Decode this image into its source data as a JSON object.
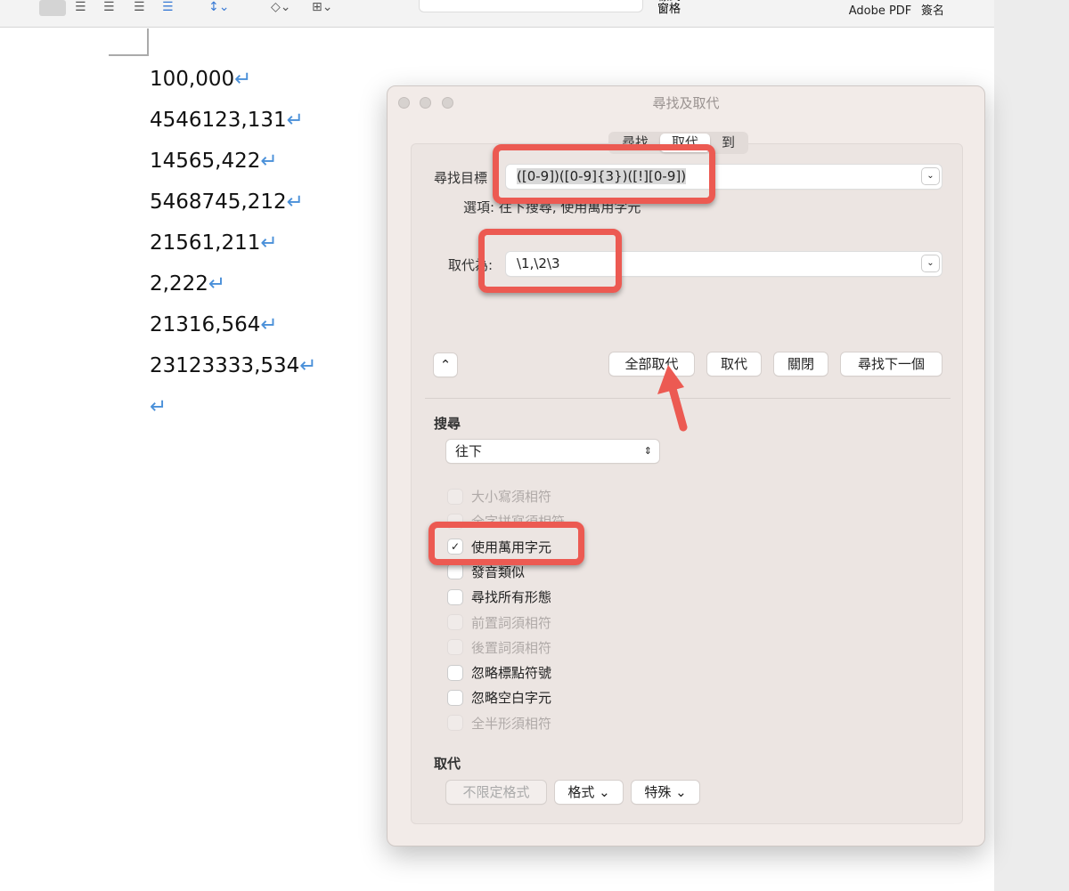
{
  "toolbar": {
    "styles_pane": "樣式\n窗格",
    "styles_pane_line2": "窗格",
    "adobe_pdf": "Adobe PDF",
    "request_sign": "簽名"
  },
  "document": {
    "lines": [
      "100,000",
      "4546123,131",
      "14565,422",
      "5468745,212",
      "21561,211",
      "2,222",
      "21316,564",
      "23123333,534",
      ""
    ],
    "return_mark": "↵"
  },
  "dialog": {
    "title": "尋找及取代",
    "tabs": [
      "尋找",
      "取代",
      "到"
    ],
    "active_tab": "取代",
    "find_label": "尋找目標",
    "find_value": "([0-9])([0-9]{3})([!][0-9])",
    "options_text": "選項: 往下搜尋, 使用萬用字元",
    "replace_label": "取代為:",
    "replace_value": "\\1,\\2\\3",
    "buttons": {
      "replace_all": "全部取代",
      "replace": "取代",
      "close": "關閉",
      "find_next": "尋找下一個"
    },
    "search_heading": "搜尋",
    "search_direction": "往下",
    "checkboxes": [
      {
        "label": "大小寫須相符",
        "checked": false,
        "enabled": false
      },
      {
        "label": "全字拼寫須相符",
        "checked": false,
        "enabled": false
      },
      {
        "label": "使用萬用字元",
        "checked": true,
        "enabled": true
      },
      {
        "label": "發音類似",
        "checked": false,
        "enabled": true
      },
      {
        "label": "尋找所有形態",
        "checked": false,
        "enabled": true
      },
      {
        "label": "前置詞須相符",
        "checked": false,
        "enabled": false
      },
      {
        "label": "後置詞須相符",
        "checked": false,
        "enabled": false
      },
      {
        "label": "忽略標點符號",
        "checked": false,
        "enabled": true
      },
      {
        "label": "忽略空白字元",
        "checked": false,
        "enabled": true
      },
      {
        "label": "全半形須相符",
        "checked": false,
        "enabled": false
      }
    ],
    "replace_heading": "取代",
    "bottom_buttons": {
      "no_format": "不限定格式",
      "format": "格式",
      "special": "特殊"
    }
  },
  "colors": {
    "annotation": "#ec5a52",
    "dialog_bg": "#f2ebe8",
    "return_mark": "#4a90d9"
  }
}
